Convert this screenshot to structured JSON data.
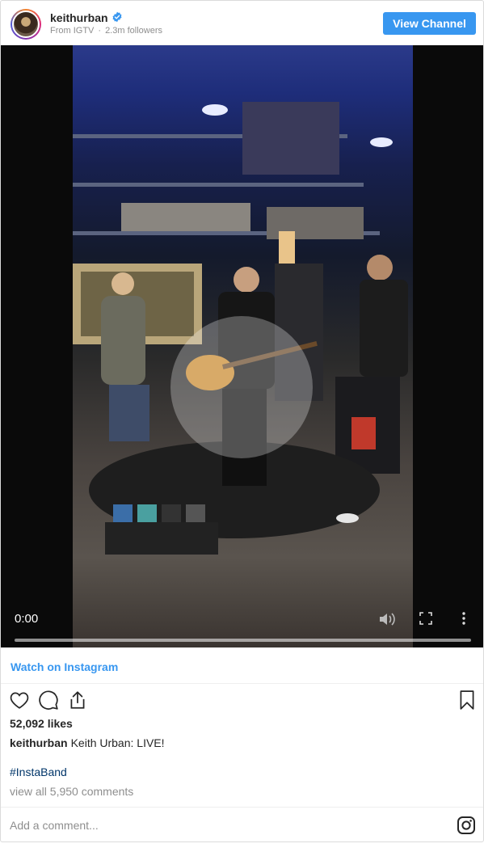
{
  "header": {
    "username": "keithurban",
    "source": "From IGTV",
    "separator": "·",
    "followers": "2.3m followers",
    "view_channel_label": "View Channel"
  },
  "video": {
    "time": "0:00",
    "progress": 0
  },
  "watch_on_instagram": "Watch on Instagram",
  "likes": "52,092 likes",
  "caption": {
    "user": "keithurban",
    "text": "Keith Urban: LIVE!"
  },
  "hashtag": "#InstaBand",
  "view_comments": "view all 5,950 comments",
  "add_comment_placeholder": "Add a comment...",
  "colors": {
    "accent": "#3897f0",
    "hashtag": "#003569",
    "muted": "#8e8e8e"
  },
  "icons": [
    "verified-badge-icon",
    "play-icon",
    "volume-icon",
    "fullscreen-icon",
    "more-options-icon",
    "heart-icon",
    "comment-icon",
    "share-icon",
    "bookmark-icon",
    "instagram-logo-icon"
  ]
}
